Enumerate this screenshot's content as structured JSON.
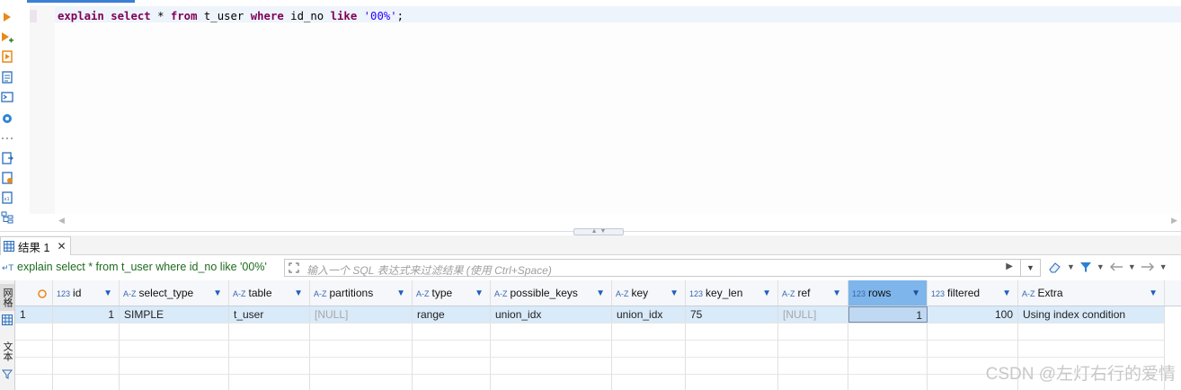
{
  "editor": {
    "sql_keyword_explain": "explain",
    "sql_keyword_select": "select",
    "sql_star": "*",
    "sql_keyword_from": "from",
    "sql_table": "t_user",
    "sql_keyword_where": "where",
    "sql_column": "id_no",
    "sql_keyword_like": "like",
    "sql_string": "'00%'",
    "sql_terminator": ";"
  },
  "left_toolbar": {
    "icons": [
      "execute-statement-icon",
      "execute-statement-new-tab-icon",
      "execute-script-icon",
      "explain-plan-icon",
      "sql-console-icon",
      "settings-icon",
      "more-icon",
      "export-icon",
      "new-script-icon",
      "sql-file-icon",
      "outline-icon"
    ]
  },
  "results": {
    "tab_label": "结果 1",
    "query_echo": "explain select * from t_user where id_no like '00%'",
    "filter_placeholder": "输入一个 SQL 表达式来过滤结果 (使用 Ctrl+Space)",
    "side_tabs": [
      "网格",
      "文本"
    ],
    "columns": [
      {
        "type_icon": "",
        "name": ""
      },
      {
        "type_icon": "123",
        "name": "id"
      },
      {
        "type_icon": "A-Z",
        "name": "select_type"
      },
      {
        "type_icon": "A-Z",
        "name": "table"
      },
      {
        "type_icon": "A-Z",
        "name": "partitions"
      },
      {
        "type_icon": "A-Z",
        "name": "type"
      },
      {
        "type_icon": "A-Z",
        "name": "possible_keys"
      },
      {
        "type_icon": "A-Z",
        "name": "key"
      },
      {
        "type_icon": "123",
        "name": "key_len"
      },
      {
        "type_icon": "A-Z",
        "name": "ref"
      },
      {
        "type_icon": "123",
        "name": "rows"
      },
      {
        "type_icon": "123",
        "name": "filtered"
      },
      {
        "type_icon": "A-Z",
        "name": "Extra"
      }
    ],
    "rows": [
      [
        "1",
        "1",
        "SIMPLE",
        "t_user",
        "[NULL]",
        "range",
        "union_idx",
        "union_idx",
        "75",
        "[NULL]",
        "1",
        "100",
        "Using index condition"
      ]
    ]
  },
  "watermark": "CSDN @左灯右行的爱情",
  "colors": {
    "keyword": "#7f0055",
    "string": "#2a00ff",
    "selected_header": "#7eb5ea",
    "selected_row": "#d9eaf9",
    "query_echo": "#1e6b1e"
  }
}
